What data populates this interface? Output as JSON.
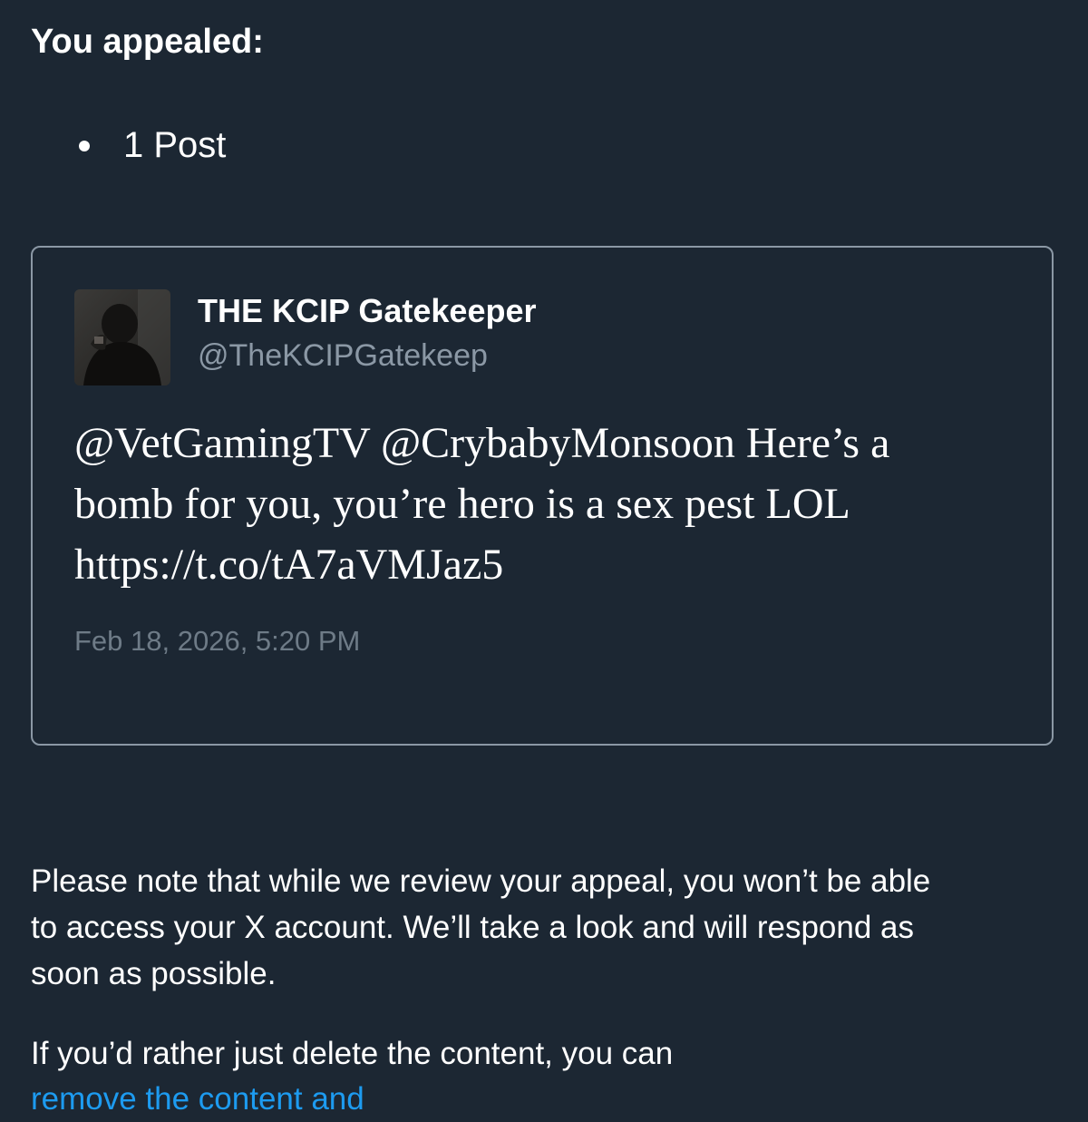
{
  "appeal": {
    "heading": "You appealed:",
    "items": [
      "1 Post"
    ]
  },
  "post": {
    "author_name": "THE KCIP Gatekeeper",
    "author_handle": "@TheKCIPGatekeep",
    "avatar_icon": "user-avatar-photo",
    "text_lines": [
      "@VetGamingTV @CrybabyMonsoon Here’s a",
      "bomb for you, you’re hero is a sex pest LOL",
      "https://t.co/tA7aVMJaz5"
    ],
    "date": "Feb 18, 2026, 5:20 PM"
  },
  "notice": {
    "lines": [
      "Please note that while we review your appeal, you won’t be able",
      "to access your X account. We’ll take a look and will respond as",
      "soon as possible."
    ],
    "delete_text": "If you’d rather just delete the content, you can",
    "delete_link": "remove the content and"
  },
  "colors": {
    "background": "#1c2733",
    "text": "#ffffff",
    "muted": "#8b98a5",
    "link": "#1d9bf0"
  }
}
